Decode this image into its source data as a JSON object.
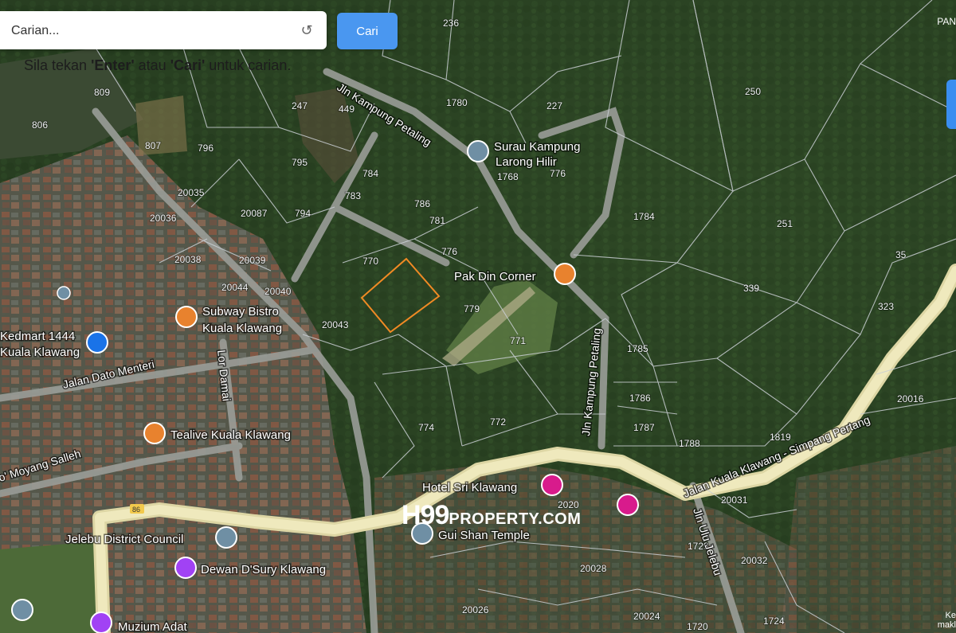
{
  "search": {
    "placeholder": "Carian...",
    "button_label": "Cari",
    "reset_icon": "reset-icon"
  },
  "hint": {
    "prefix": "Sila tekan ",
    "enter": "'Enter'",
    "middle": " atau ",
    "cari": "'Cari'",
    "suffix": " untuk carian."
  },
  "corner": {
    "top_right": "PAN",
    "bottom_right_1": "Ke",
    "bottom_right_2": "makl"
  },
  "roads": {
    "jln_kampung_petaling_top": "Jln Kampung Petaling",
    "jln_kampung_petaling_side": "Jln Kampung Petaling",
    "jalan_kuala_klawang": "Jalan Kuala Klawang - Simpang Pertang",
    "jalan_dato_menteri": "Jalan Dato Menteri",
    "lor_damai": "Lor Damai",
    "moyang_salleh": "o' Moyang Salleh",
    "jln_ulu_jelebu": "Jln Ulu Jelebu",
    "route_shield": "86"
  },
  "pois": {
    "surau": "Surau Kampung Larong Hilir",
    "surau_line1": "Surau Kampung",
    "surau_line2": "Larong Hilir",
    "pak_din": "Pak Din Corner",
    "subway_line1": "Subway Bistro",
    "subway_line2": "Kuala Klawang",
    "kedmart_line1": "Kedmart 1444",
    "kedmart_line2": "Kuala Klawang",
    "tealive": "Tealive Kuala Klawang",
    "hotel": "Hotel Sri Klawang",
    "gui_shan": "Gui Shan Temple",
    "jelebu_council": "Jelebu District Council",
    "dewan": "Dewan D'Sury Klawang",
    "muzium": "Muzium Adat"
  },
  "lots": [
    "806",
    "809",
    "807",
    "796",
    "247",
    "449",
    "1780",
    "227",
    "236",
    "250",
    "795",
    "784",
    "783",
    "786",
    "794",
    "20087",
    "20036",
    "20035",
    "20038",
    "20039",
    "20044",
    "20040",
    "20043",
    "1784",
    "251",
    "35",
    "339",
    "323",
    "779",
    "770",
    "771",
    "776",
    "781",
    "1785",
    "1786",
    "1787",
    "1788",
    "1819",
    "774",
    "772",
    "20031",
    "2020",
    "20028",
    "20032",
    "20026",
    "20024",
    "1720",
    "1724",
    "20016",
    "776",
    "1729",
    "1768"
  ],
  "watermark": {
    "brand": "H99",
    "domain": "PROPERTY.COM"
  },
  "colors": {
    "highlight_parcel": "#f08a24",
    "poi_orange": "#e8822e",
    "poi_blue": "#1a73e8",
    "poi_purple": "#a142f4",
    "poi_pink": "#d81b8c",
    "poi_grey": "#6f8fa4",
    "search_button": "#4a97f0"
  }
}
